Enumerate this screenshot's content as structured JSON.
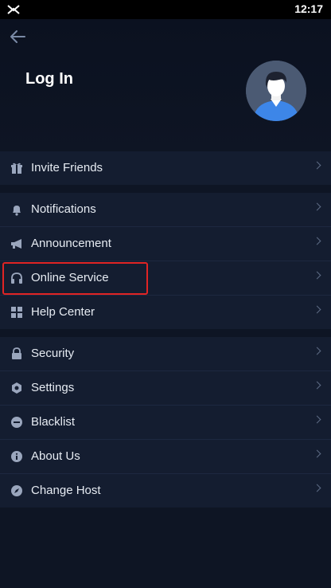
{
  "status_bar": {
    "time": "12:17"
  },
  "header": {
    "title": "Log In"
  },
  "colors": {
    "background": "#0e1524",
    "row": "#141d30",
    "icon": "#9aa6bd",
    "highlight": "#e02424"
  },
  "menu_groups": [
    {
      "items": [
        {
          "label": "Invite Friends",
          "icon": "gift-icon"
        }
      ]
    },
    {
      "items": [
        {
          "label": "Notifications",
          "icon": "bell-icon"
        },
        {
          "label": "Announcement",
          "icon": "megaphone-icon"
        },
        {
          "label": "Online Service",
          "icon": "headset-icon"
        },
        {
          "label": "Help Center",
          "icon": "grid-icon"
        }
      ]
    },
    {
      "items": [
        {
          "label": "Security",
          "icon": "lock-icon"
        },
        {
          "label": "Settings",
          "icon": "hexagon-settings-icon"
        },
        {
          "label": "Blacklist",
          "icon": "block-icon"
        },
        {
          "label": "About Us",
          "icon": "info-icon"
        },
        {
          "label": "Change Host",
          "icon": "compass-icon"
        }
      ]
    }
  ]
}
